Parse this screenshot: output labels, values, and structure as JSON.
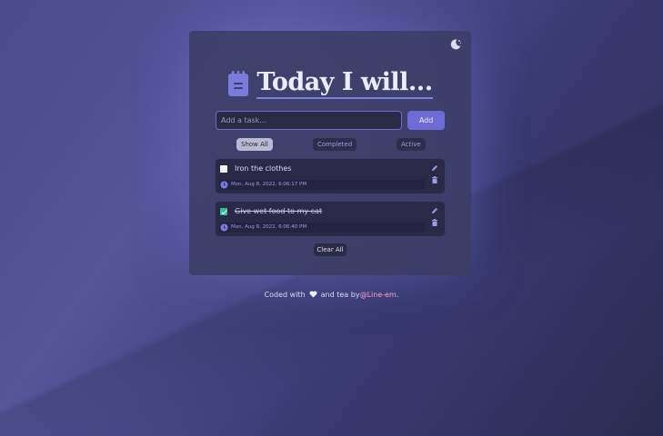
{
  "header": {
    "title": "Today I will..."
  },
  "add_form": {
    "placeholder": "Add a task...",
    "value": "",
    "add_label": "Add"
  },
  "filters": [
    {
      "label": "Show All",
      "active": true
    },
    {
      "label": "Completed",
      "active": false
    },
    {
      "label": "Active",
      "active": false
    }
  ],
  "tasks": [
    {
      "text": "Iron the clothes",
      "done": false,
      "timestamp": "Mon, Aug 8, 2022, 6:06:17 PM"
    },
    {
      "text": "Give wet food to my cat",
      "done": true,
      "timestamp": "Mon, Aug 8, 2022, 6:06:40 PM"
    }
  ],
  "clear_label": "Clear All",
  "footer": {
    "prefix": "Coded with",
    "middle": "and tea by",
    "author": "@Line-em",
    "suffix": "."
  },
  "icons": {
    "theme_toggle": "moon-icon",
    "logo": "notepad-icon",
    "clock": "clock-icon",
    "edit": "pencil-icon",
    "delete": "trash-icon",
    "heart": "heart-icon"
  },
  "colors": {
    "accent": "#6c6cd4",
    "checked": "#2cc295",
    "link": "#f0a3c8"
  }
}
